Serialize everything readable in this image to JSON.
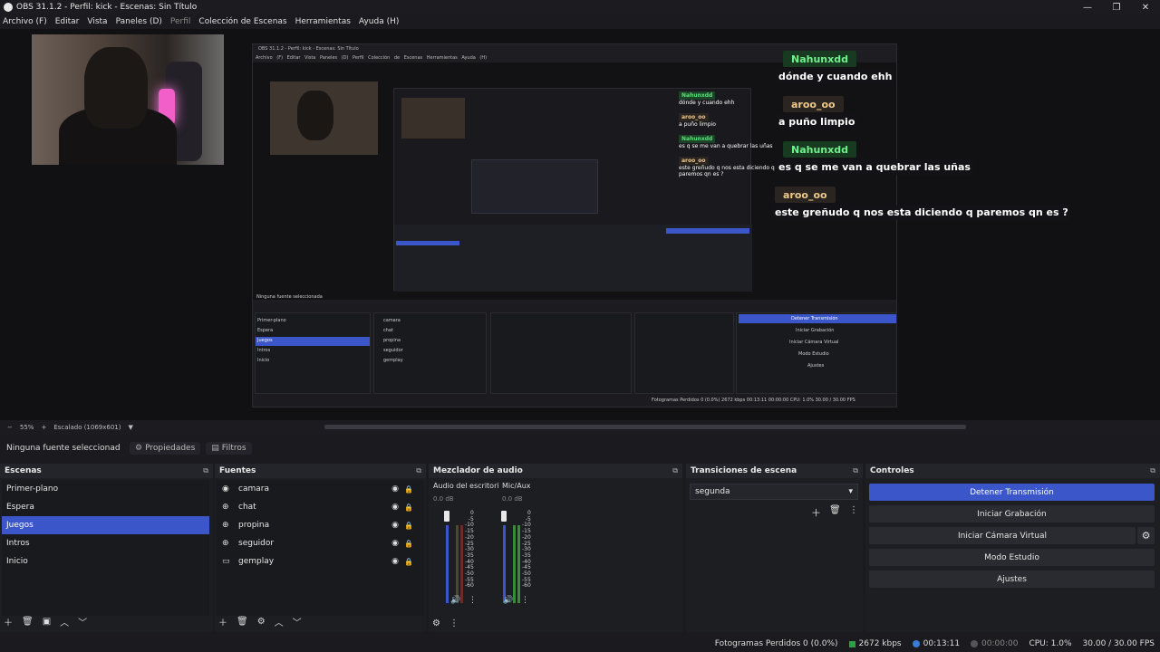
{
  "window": {
    "title": "OBS 31.1.2 - Perfil: kick - Escenas: Sin Título"
  },
  "menu": [
    "Archivo (F)",
    "Editar",
    "Vista",
    "Paneles (D)",
    "Perfil",
    "Colección de Escenas",
    "Herramientas",
    "Ayuda (H)"
  ],
  "nested": {
    "title": "OBS 31.1.2 - Perfil: kick - Escenas: Sin Título",
    "menu": "Archivo (F) Editar Vista Paneles (D) Perfil Colección de Escenas Herramientas Ayuda (H)",
    "source_none": "Ninguna fuente seleccionada",
    "scenes": [
      "Primer-plano",
      "Espera",
      "Juegos",
      "Intros",
      "Inicio"
    ],
    "sources": [
      "camara",
      "chat",
      "propina",
      "seguidor",
      "gemplay"
    ],
    "controls": [
      "Detener Transmisión",
      "Iniciar Grabación",
      "Iniciar Cámara Virtual",
      "Modo Estudio",
      "Ajustes"
    ],
    "status": "Fotogramas Perdidos 0 (0.0%)   2672 kbps   00:13:11   00:00:00   CPU: 1.0%   30.00 / 30.00 FPS",
    "chat": [
      {
        "user": "Nahunxdd",
        "msg": "dónde y cuando ehh"
      },
      {
        "user": "aroo_oo",
        "msg": "a puño limpio"
      },
      {
        "user": "Nahunxdd",
        "msg": "es q se me van a quebrar las uñas"
      },
      {
        "user": "aroo_oo",
        "msg": "este greñudo q nos esta diciendo q paremos qn es ?"
      }
    ]
  },
  "chat": [
    {
      "user": "Nahunxdd",
      "msg": "dónde y cuando ehh"
    },
    {
      "user": "aroo_oo",
      "msg": "a puño limpio"
    },
    {
      "user": "Nahunxdd",
      "msg": "es q se me van a quebrar las uñas"
    },
    {
      "user": "aroo_oo",
      "msg": "este greñudo q nos esta diciendo q paremos qn es ?"
    }
  ],
  "preview_bar": {
    "zoom": "55%",
    "scale": "Escalado (1069x601)"
  },
  "source_bar": {
    "none_label": "Ninguna fuente seleccionad",
    "properties": "Propiedades",
    "filters": "Filtros"
  },
  "scenes": {
    "title": "Escenas",
    "items": [
      "Primer-plano",
      "Espera",
      "Juegos",
      "Intros",
      "Inicio"
    ],
    "selected": "Juegos"
  },
  "sources": {
    "title": "Fuentes",
    "items": [
      {
        "name": "camara",
        "icon": "camera-icon"
      },
      {
        "name": "chat",
        "icon": "browser-icon"
      },
      {
        "name": "propina",
        "icon": "browser-icon"
      },
      {
        "name": "seguidor",
        "icon": "browser-icon"
      },
      {
        "name": "gemplay",
        "icon": "display-icon"
      }
    ]
  },
  "mixer": {
    "title": "Mezclador de audio",
    "channels": [
      {
        "name": "Audio del escritorio",
        "db": "0.0 dB"
      },
      {
        "name": "Mic/Aux",
        "db": "0.0 dB"
      }
    ],
    "scale": [
      "0",
      "-5",
      "-10",
      "-15",
      "-20",
      "-25",
      "-30",
      "-35",
      "-40",
      "-45",
      "-50",
      "-55",
      "-60"
    ]
  },
  "transitions": {
    "title": "Transiciones de escena",
    "selected": "segunda"
  },
  "controls": {
    "title": "Controles",
    "buttons": [
      "Detener Transmisión",
      "Iniciar Grabación",
      "Iniciar Cámara Virtual",
      "Modo Estudio",
      "Ajustes"
    ]
  },
  "status": {
    "dropped": "Fotogramas Perdidos 0 (0.0%)",
    "bitrate": "2672 kbps",
    "live_time": "00:13:11",
    "rec_time": "00:00:00",
    "cpu": "CPU: 1.0%",
    "fps": "30.00 / 30.00 FPS"
  }
}
